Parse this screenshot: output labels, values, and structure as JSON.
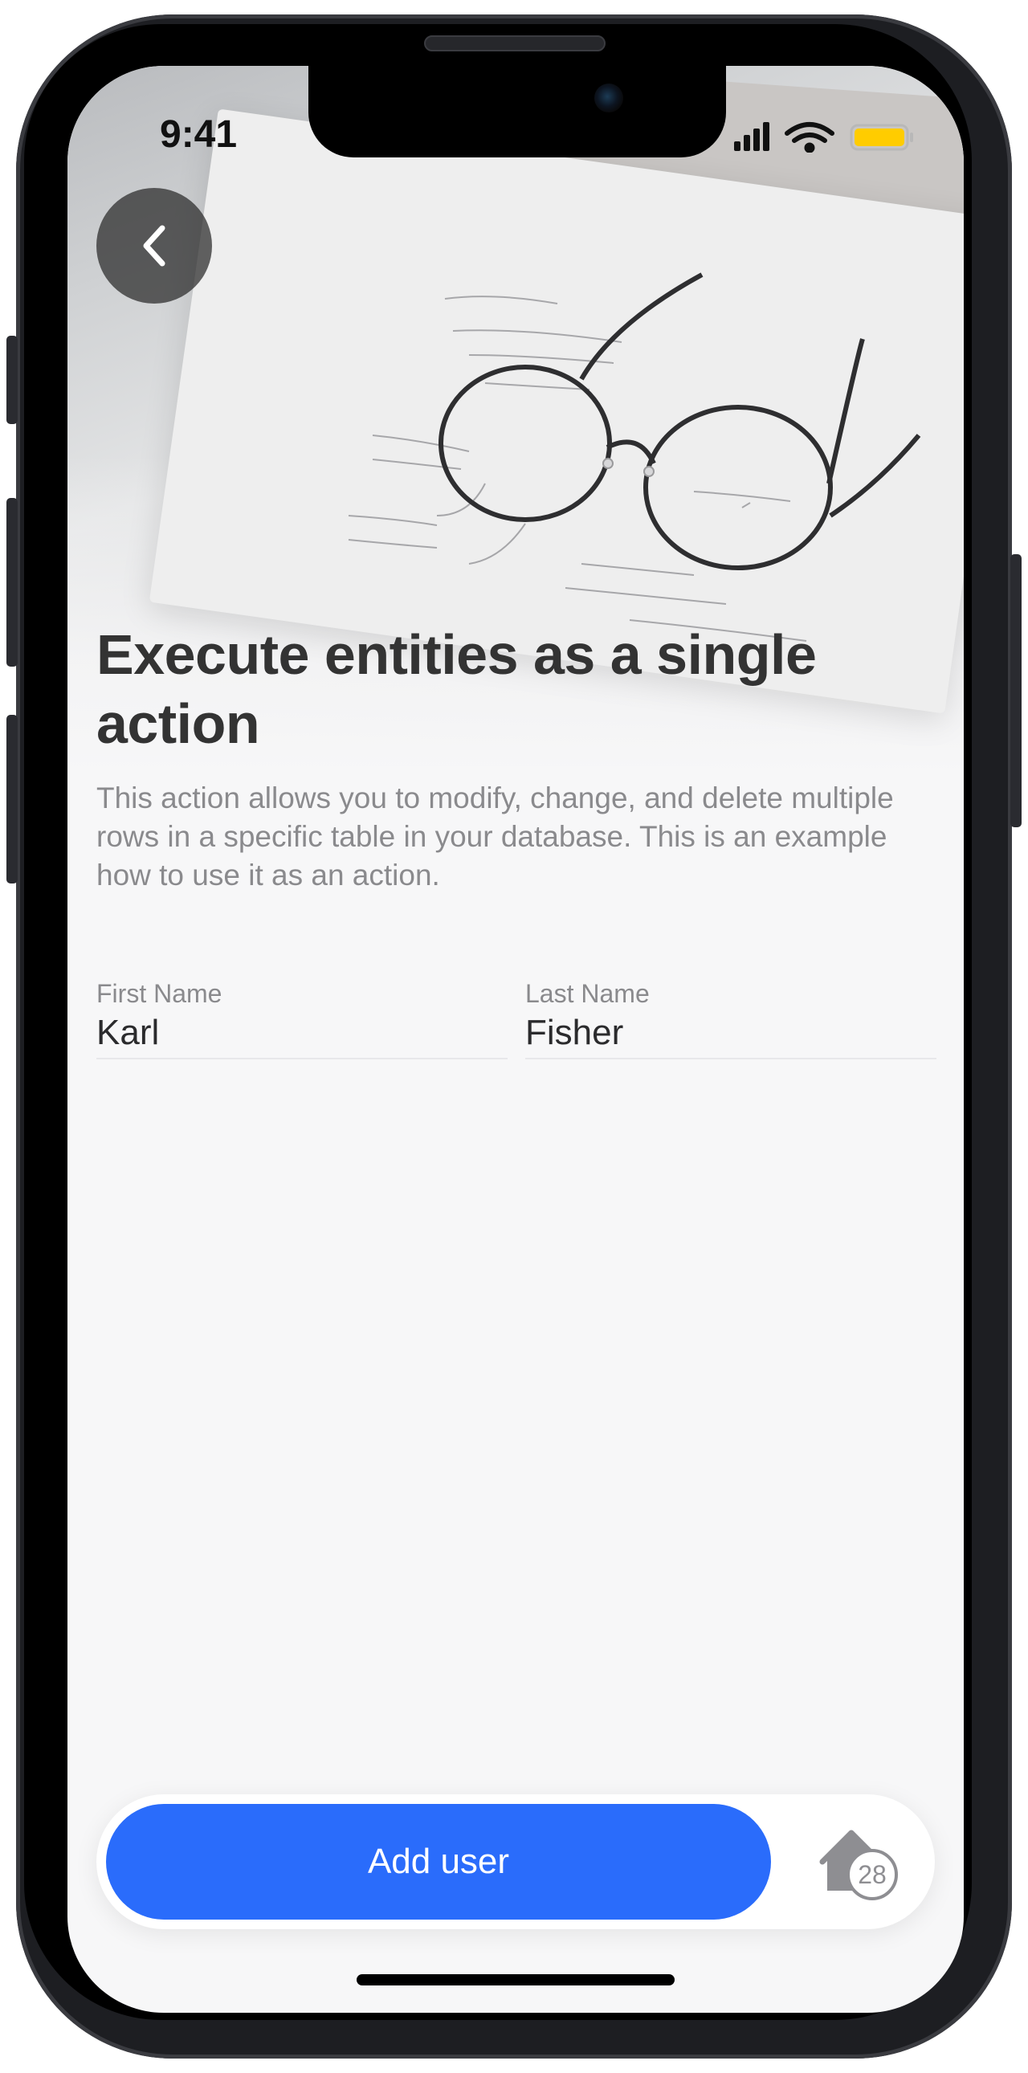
{
  "status_bar": {
    "time": "9:41"
  },
  "header": {
    "title": "Execute entities as a single action",
    "description": "This action allows you to modify, change, and delete multiple rows in a specific table in your database. This is an example how to use it as an action."
  },
  "form": {
    "first_name": {
      "label": "First Name",
      "value": "Karl"
    },
    "last_name": {
      "label": "Last Name",
      "value": "Fisher"
    }
  },
  "bottom_bar": {
    "primary_button_label": "Add user",
    "home_badge_count": "28"
  },
  "colors": {
    "accent": "#2a6cfb",
    "title_text": "#333333",
    "secondary_text": "#8a8a8d",
    "battery": "#ffcc00"
  },
  "icons": [
    "back-chevron-icon",
    "signal-icon",
    "wifi-icon",
    "battery-icon",
    "home-icon"
  ]
}
